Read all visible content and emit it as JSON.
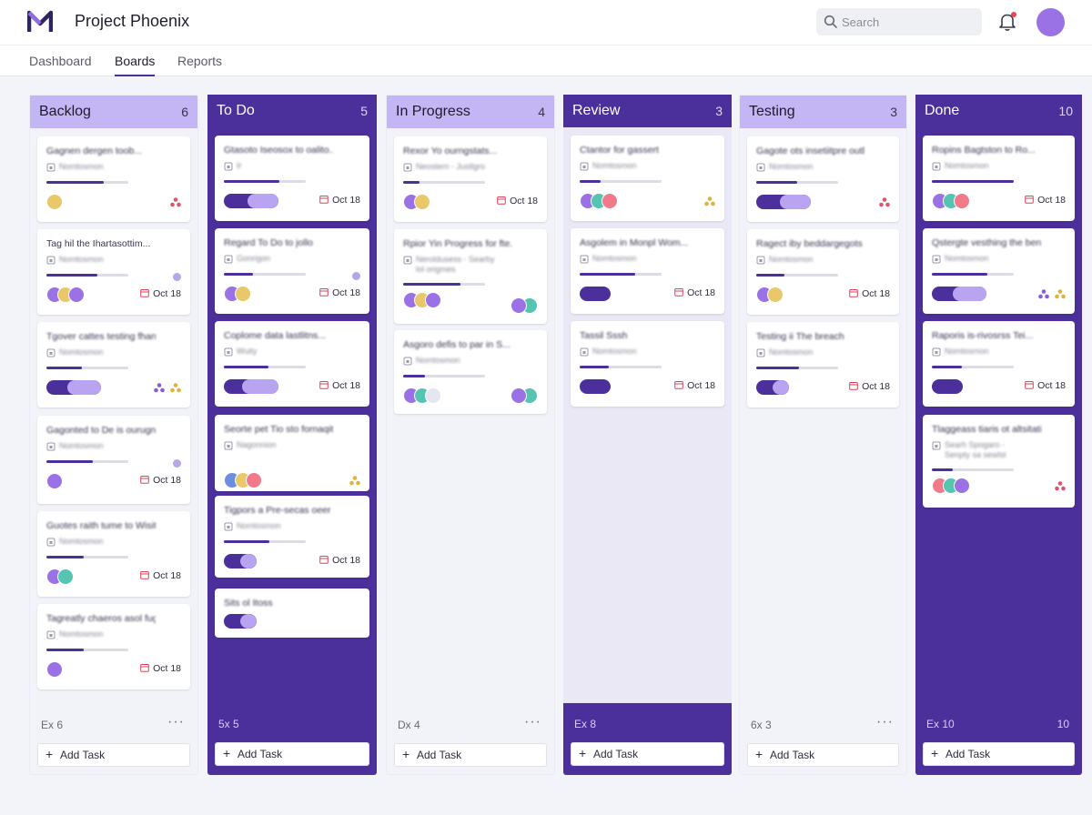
{
  "app": {
    "project_title": "Project Phoenix",
    "search_placeholder": "Search"
  },
  "tabs": [
    {
      "label": "Dashboard",
      "active": false
    },
    {
      "label": "Boards",
      "active": true
    },
    {
      "label": "Reports",
      "active": false
    }
  ],
  "colors": {
    "primary": "#4b2f9b",
    "lavender": "#c4b5f4",
    "accent_light": "#b9a4f2",
    "notification": "#e5484d"
  },
  "add_task_label": "Add Task",
  "columns": [
    {
      "title": "Backlog",
      "count": "6",
      "footer_label": "Ex 6",
      "footer_more": "···",
      "style": "light",
      "cards": [
        {
          "title": "Gagnen dergen toob...",
          "meta": "Nomtosmon",
          "progress": 0.7,
          "avatars": [
            "#e8c868"
          ],
          "due": "",
          "tags": [
            "people-red"
          ]
        },
        {
          "title": "Tag hil the Ihartasottim...",
          "meta": "Nomtosmon",
          "progress": 0.62,
          "avatars": [
            "#9a72e6",
            "#e8c868",
            "#9a72e6"
          ],
          "due": "Oct 18",
          "tags": [
            "badge"
          ]
        },
        {
          "title": "Tgover cattes testing fhano...",
          "meta": "Nomtosmon",
          "progress": 0.43,
          "avatars": [],
          "pill": 0.55,
          "due": "",
          "tags": [
            "people-purple",
            "people-yellow"
          ]
        },
        {
          "title": "Gagonted to De is ourugno...",
          "meta": "Nomtosmon",
          "progress": 0.57,
          "avatars": [
            "#9a72e6"
          ],
          "due": "Oct 18",
          "tags": [
            "badge"
          ]
        },
        {
          "title": "Guotes raith tume to Wisit...",
          "meta": "Nomtosmon",
          "progress": 0.46,
          "avatars": [
            "#9a72e6",
            "#55c4b2"
          ],
          "due": "Oct 18",
          "tags": []
        },
        {
          "title": "Tagreatly chaeros asol fugh...",
          "meta": "Nomtosmon",
          "progress": 0.46,
          "avatars": [
            "#9a72e6"
          ],
          "due": "Oct 18",
          "tags": []
        }
      ]
    },
    {
      "title": "To Do",
      "count": "5",
      "footer_label": "5x 5",
      "footer_more": "",
      "style": "dark",
      "cards": [
        {
          "title": "Gtasoto Iseosox to oalito...",
          "meta": "Ir",
          "progress": 0.68,
          "avatars": [],
          "pill": 0.5,
          "due": "Oct 18",
          "tags": []
        },
        {
          "title": "Regard To Do to jollo",
          "meta": "Gonrigon",
          "progress": 0.35,
          "avatars": [
            "#9a72e6",
            "#e8c868"
          ],
          "due": "Oct 18",
          "tags": [
            "badge"
          ]
        },
        {
          "title": "Coplome data lastlitns...",
          "meta": "Wuity",
          "progress": 0.54,
          "avatars": [],
          "pill": 0.6,
          "due": "Oct 18",
          "tags": []
        },
        {
          "title": "Seorte pet Tio sto fornaqite...",
          "meta": "Nagonnion",
          "progress": 0,
          "avatars": [
            "#6b8ee0",
            "#e8c868",
            "#f07a8a"
          ],
          "due": "",
          "tags": [
            "people-yellow"
          ]
        },
        {
          "title": "Tigpors a Pre-secas oeer",
          "meta": "Nomtosmon",
          "progress": 0.55,
          "avatars": [],
          "pill": 0.22,
          "due": "Oct 18",
          "tags": []
        },
        {
          "title": "Sits ol Itoss",
          "meta": "",
          "progress": 0,
          "avatars": [],
          "pill": 0.1,
          "due": "",
          "tags": []
        }
      ]
    },
    {
      "title": "In Progress",
      "count": "4",
      "footer_label": "Dx 4",
      "footer_more": "···",
      "style": "light",
      "cards": [
        {
          "title": "Rexor Yo ourngstats...",
          "meta": "Neostern - Justlgro",
          "progress": 0.2,
          "avatars": [
            "#9a72e6",
            "#e8c868"
          ],
          "due": "Oct 18",
          "tags": []
        },
        {
          "title": "Rpior Yin Progress for fte...",
          "meta": "Neroldusess - Searby lol origmes",
          "progress": 0.7,
          "avatars": [
            "#9a72e6",
            "#e8c868",
            "#9a72e6"
          ],
          "due": "",
          "tags": [
            "avatar-pair"
          ]
        },
        {
          "title": "Asgoro defis to par in S...",
          "meta": "Nomtosmon",
          "progress": 0.27,
          "avatars": [
            "#9a72e6",
            "#55c4b2",
            "#e4e6f0"
          ],
          "due": "",
          "tags": [
            "avatar-pair"
          ]
        }
      ]
    },
    {
      "title": "Review",
      "count": "3",
      "footer_label": "Ex 8",
      "footer_more": "",
      "style": "light-review",
      "cards": [
        {
          "title": "Ctantor for gassert",
          "meta": "Nomtosmon",
          "progress": 0.25,
          "avatars": [
            "#9a72e6",
            "#55c4b2",
            "#f07a8a"
          ],
          "due": "",
          "tags": [
            "people-yellow"
          ]
        },
        {
          "title": "Asgolem in Monpl Wom...",
          "meta": "Nomtosmon",
          "progress": 0.68,
          "avatars": [],
          "pill": 0,
          "due": "Oct 18",
          "tags": []
        },
        {
          "title": "Tassil Sssh",
          "meta": "Nomtosmon",
          "progress": 0.35,
          "avatars": [],
          "pill": 0,
          "due": "Oct 18",
          "tags": []
        }
      ]
    },
    {
      "title": "Testing",
      "count": "3",
      "footer_label": "6x 3",
      "footer_more": "···",
      "style": "light",
      "cards": [
        {
          "title": "Gagote ots insetiitpre outl...",
          "meta": "Nomtosmon",
          "progress": 0.5,
          "avatars": [],
          "pill": 0.5,
          "due": "",
          "tags": [
            "people-red"
          ]
        },
        {
          "title": "Ragect iby beddargegots",
          "meta": "Nomtosmon",
          "progress": 0.34,
          "avatars": [
            "#9a72e6",
            "#e8c868"
          ],
          "due": "Oct 18",
          "tags": []
        },
        {
          "title": "Testing ii The breach",
          "meta": "Nomtosmon",
          "progress": 0.52,
          "avatars": [],
          "pill": 0.2,
          "due": "Oct 18",
          "tags": []
        }
      ]
    },
    {
      "title": "Done",
      "count": "10",
      "footer_label": "Ex 10",
      "footer_more": "10",
      "style": "dark",
      "cards": [
        {
          "title": "Ropins Bagtston to Ro...",
          "meta": "Nomtosmon",
          "progress": 1,
          "avatars": [
            "#9a72e6",
            "#55c4b2",
            "#f07a8a"
          ],
          "due": "Oct 18",
          "tags": []
        },
        {
          "title": "Qstergte vesthing the ben...",
          "meta": "Nomtosmon",
          "progress": 0.68,
          "avatars": [],
          "pill": 0.55,
          "due": "",
          "tags": [
            "people-purple",
            "people-yellow"
          ]
        },
        {
          "title": "Raporis is-rivosrss Tei...",
          "meta": "Nomtosmon",
          "progress": 0.37,
          "avatars": [],
          "pill": 0,
          "due": "Oct 18",
          "tags": []
        },
        {
          "title": "Tlaggeass tiaris ot altsitatia...",
          "meta": "Searh Spogaro - Senpty sa sewlst",
          "progress": 0.25,
          "avatars": [
            "#f07a8a",
            "#55c4b2",
            "#9a72e6"
          ],
          "due": "",
          "tags": [
            "people-red"
          ]
        }
      ]
    }
  ]
}
